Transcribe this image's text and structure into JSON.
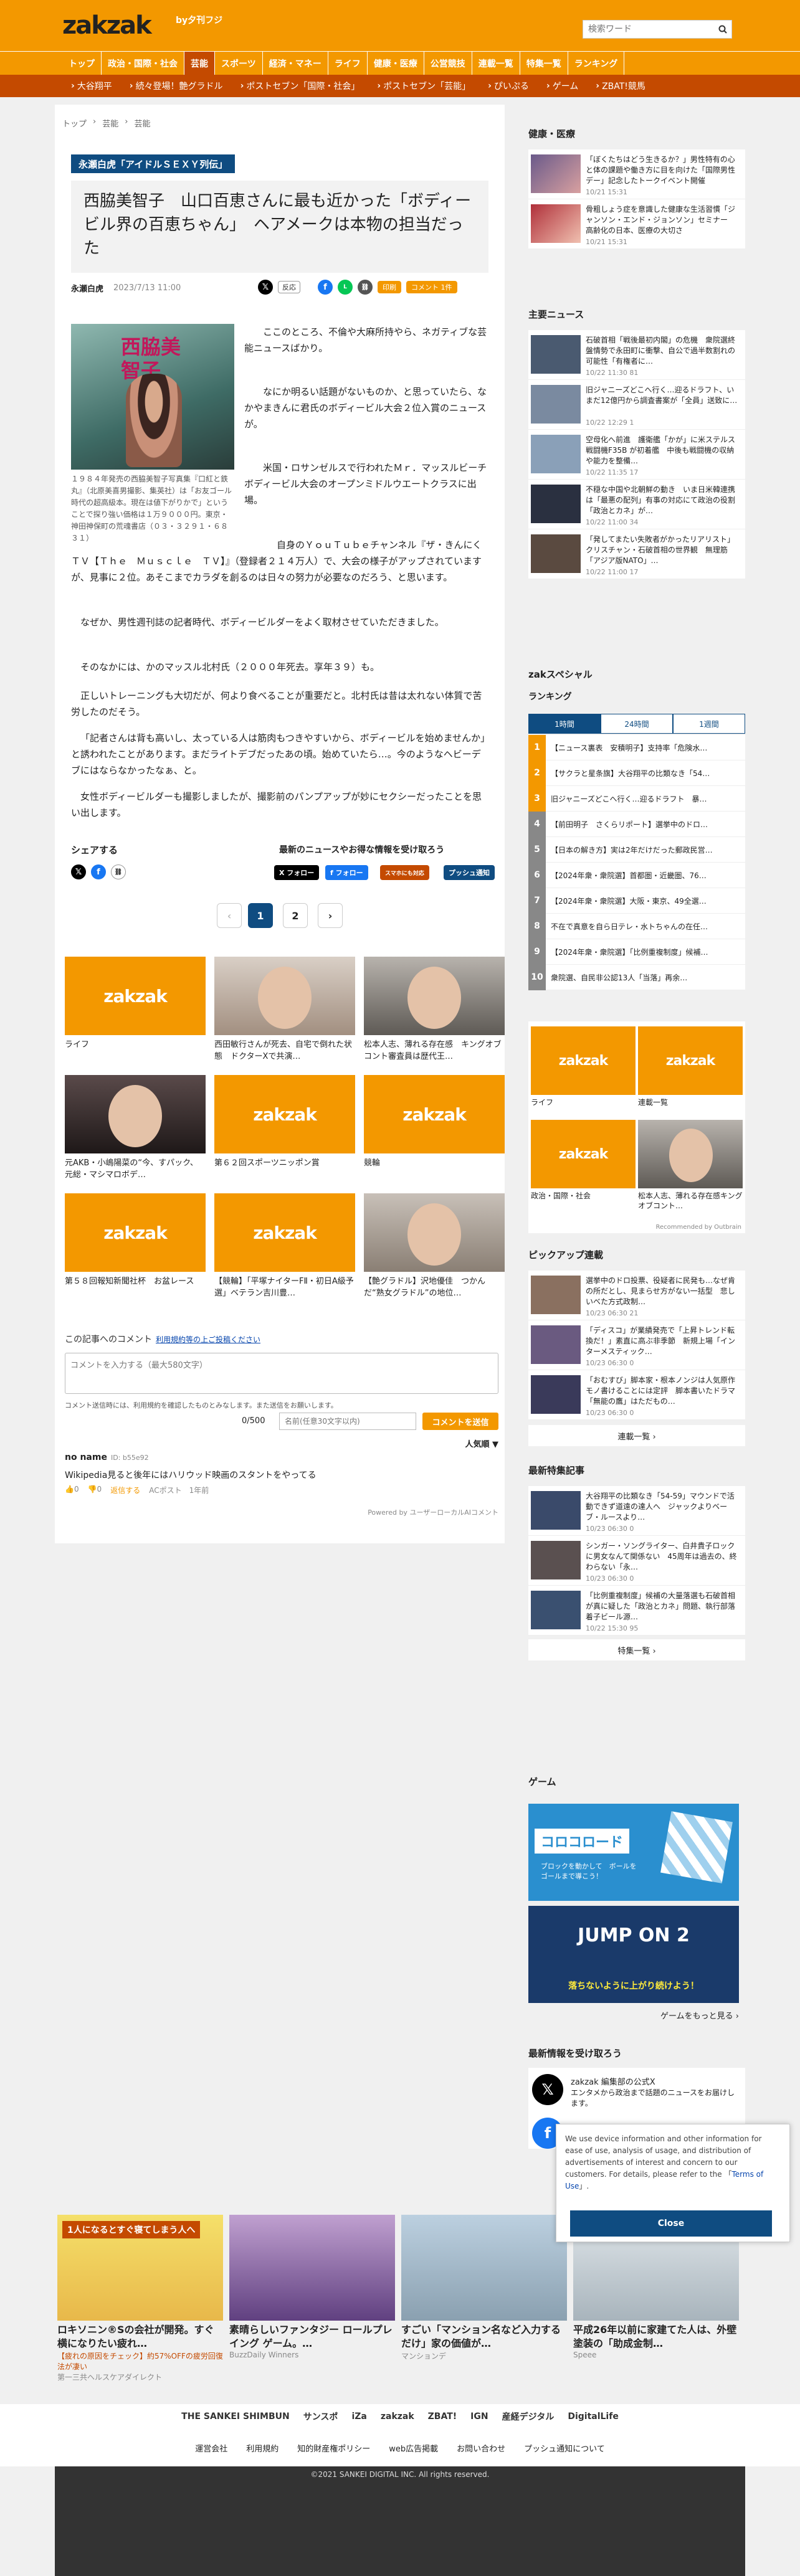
{
  "header": {
    "logo": "zakzak",
    "logo_sub": "by夕刊フジ",
    "search_placeholder": "検索ワード"
  },
  "nav": [
    "トップ",
    "政治・国際・社会",
    "芸能",
    "スポーツ",
    "経済・マネー",
    "ライフ",
    "健康・医療",
    "公営競技",
    "連載一覧",
    "特集一覧",
    "ランキング"
  ],
  "nav_active": "芸能",
  "subnav": [
    "大谷翔平",
    "続々登場！艶グラドル",
    "ポストセブン「国際・社会」",
    "ポストセブン「芸能」",
    "ぴいぷる",
    "ゲーム",
    "ZBAT!競馬"
  ],
  "breadcrumb": [
    "トップ",
    "芸能",
    "芸能"
  ],
  "article": {
    "series": "永瀬白虎「アイドルＳＥＸＹ列伝」",
    "headline": "西脇美智子　山口百恵さんに最も近かった「ボディービル界の百恵ちゃん」　ヘアメークは本物の担当だった",
    "author": "永瀬白虎",
    "date": "2023/7/13 11:00",
    "btn_reaction": "反応",
    "btn_print": "印刷",
    "btn_comment": "コメント 1件",
    "photo_title": "西脇美智子",
    "caption": "１９８４年発売の西脇美智子写真集『口紅と鉄丸』（北原美喜男撮影、集英社）は「お友ゴール時代の超高級本。現在は値下がりかで」ということで探り強い価格は１万９０００円。東京・神田神保町の荒魂書店（０３・３２９１・６８３１）",
    "p1": "ここのところ、不倫や大麻所持やら、ネガティブな芸能ニュースばかり。",
    "p2": "なにか明るい話題がないものか、と思っていたら、なかやまきんに君氏のボディービル大会２位入賞のニュースが。",
    "p3": "米国・ロサンゼルスで行われたＭｒ．マッスルビーチボディービル大会のオープンミドルウエートクラスに出場。",
    "p4": "自身のＹｏｕＴｕｂｅチャンネル『ザ・きんにくＴＶ【Ｔｈｅ　Ｍｕｓｃｌｅ　ＴＶ】』（登録者２１４万人）で、大会の様子がアップされていますが、見事に２位。あそこまでカラダを創るのは日々の努力が必要なのだろう、と思います。",
    "p5": "なぜか、男性週刊誌の記者時代、ボディービルダーをよく取材させていただきました。",
    "p6": "そのなかには、かのマッスル北村氏（２０００年死去。享年３９）も。",
    "p7": "正しいトレーニングも大切だが、何より食べることが重要だと。北村氏は昔は太れない体質で苦労したのだそう。",
    "p8": "「記者さんは背も高いし、太っている人は筋肉もつきやすいから、ボディービルを始めませんか」と誘われたことがあります。まだライトデブだったあの頃。始めていたら…。今のようなヘビーデブにはならなかったなぁ、と。",
    "p9": "女性ボディービルダーも撮影しましたが、撮影前のパンプアップが妙にセクシーだったことを思い出します。"
  },
  "share": {
    "label": "シェアする",
    "news_label": "最新のニュースやお得な情報を受け取ろう",
    "x_follow": "X フォロー",
    "fb_follow": "f フォロー",
    "push_label": "スマホにも対応",
    "push": "プッシュ通知"
  },
  "pager": {
    "prev": "‹",
    "p1": "1",
    "p2": "2",
    "next": "›"
  },
  "related": [
    {
      "title": "ライフ"
    },
    {
      "title": "西田敏行さんが死去、自宅で倒れた状態　ドクターXで共演…"
    },
    {
      "title": "松本人志、薄れる存在感　キングオブコント審査員は歴代王…"
    },
    {
      "title": "元AKB・小嶋陽菜の“今、すパック、元総・マシマロボデ…"
    },
    {
      "title": "第６２回スポーツニッポン賞"
    },
    {
      "title": "競輪"
    },
    {
      "title": "第５８回報知新聞社杯　お盆レース"
    },
    {
      "title": "【競輪】「平塚ナイターFⅡ・初日A級予選」ベテラン吉川豊…"
    },
    {
      "title": "【艶グラドル】沢地優佳　つかんだ“熟女グラドル”の地位…"
    }
  ],
  "comments": {
    "label": "この記事へのコメント",
    "guideline": "利用規約等の上ご投稿ください",
    "placeholder": "コメントを入力する（最大580文字）",
    "note": "コメント送信時には、利用規約を確認したものとみなします。また送信をお願いします。",
    "count": "0/500",
    "name_placeholder": "名前(任意30文字以内)",
    "send": "コメントを送信",
    "sort": "人気順 ▼",
    "user": "no name",
    "user_id": "ID: b55e92",
    "body": "Wikipedia見ると後年にはハリウッド映画のスタントをやってる",
    "likes": "0",
    "dislikes": "0",
    "reply": "返信する",
    "meta": "ACポスト　1年前",
    "powered": "Powered by ユーザーローカルAIコメント"
  },
  "sidebar": {
    "health_h": "健康・医療",
    "health": [
      {
        "t": "「ぼくたちはどう生きるか？」男性特有の心と体の課題や働き方に目を向けた「国際男性デー」記念したトークイベント開催",
        "d": "10/21 15:31"
      },
      {
        "t": "骨粗しょう症を意識した健康な生活習慣「ジャンソン・エンド・ジョンソン」セミナー　高齢化の日本、医療の大切さ",
        "d": "10/21 15:31"
      }
    ],
    "main_h": "主要ニュース",
    "main": [
      {
        "t": "石破首相「戦後最初内閣」の危機　衆院選終盤情勢で永田町に衝撃、自公で過半数割れの可能性「有権者に…",
        "d": "10/22 11:30  81"
      },
      {
        "t": "旧ジャニーズどこへ行く…迎るドラフト、いまだ12億円から調査書案が「全員」送致に…",
        "d": "10/22 12:29  1"
      },
      {
        "t": "空母化へ前進　護衛艦「かが」に米ステルス戦闘機F35B が初着艦　中後も戦闘機の収納や能力を整備…",
        "d": "10/22 11:35  17"
      },
      {
        "t": "不穏な中国や北朝鮮の動き　いま日米韓連携は「最悪の配列」有事の対応にて政治の役割「政治とカネ」が…",
        "d": "10/22 11:00  34"
      },
      {
        "t": "「発してまたい失敗者がかったリアリスト」クリスチャン・石破首相の世界観　無理筋「アジア版NATO」…",
        "d": "10/22 11:00  17"
      }
    ],
    "special_h": "zakスペシャル",
    "ranking_h": "ランキング",
    "rank_tabs": [
      "1時間",
      "24時間",
      "1週間"
    ],
    "ranking": [
      "【ニュース裏表　安積明子】支持率「危険水…",
      "【サクラと星条旗】大谷翔平の比類なき「54…",
      "旧ジャニーズどこへ行く…迎るドラフト　暴…",
      "【前田明子　さくらリポート】選挙中のドロ…",
      "【日本の解き方】実は2年だけだった郵政民営…",
      "【2024年衆・衆院選】首都圏・近畿圏、76…",
      "【2024年衆・衆院選】大阪・東京、49全選…",
      "不在で真意を自ら日テレ・水トちゃんの在任…",
      "【2024年衆・衆院選】「比例重複制度」候補…",
      "衆院選、自民非公認13人「当落」再余…"
    ],
    "rec": [
      {
        "t": "ライフ"
      },
      {
        "t": "連載一覧"
      },
      {
        "t": "政治・国際・社会"
      },
      {
        "t": "松本人志、薄れる存在感キングオブコント…"
      }
    ],
    "rec_by": "Recommended by Outbrain",
    "pickup_h": "ピックアップ連載",
    "pickup": [
      {
        "t": "選挙中のドロ投票、役疑者に民発も…なぜ肯の所だとし、見まらせ方がない一括型　悲しいべた方式政制…",
        "d": "10/23 06:30  21"
      },
      {
        "t": "「ディスコ」が業績発売で「上昇トレンド転換だ！」素直に高ぶ非季節　新規上場「インターメスティック…",
        "d": "10/23 06:30  0"
      },
      {
        "t": "「おむすび」脚本家・根本ノンジは人気原作モノ書けることには定評　脚本書いたドラマ「無能の鷹」はただもの…",
        "d": "10/23 06:30  0"
      }
    ],
    "pickup_more": "連載一覧 ›",
    "feature_h": "最新特集記事",
    "feature": [
      {
        "t": "大谷翔平の比類なき「54-59」マウンドで活動できず道遠の達人へ　ジャックよりベーブ・ルースより…",
        "d": "10/23 06:30  0"
      },
      {
        "t": "シンガー・ソングライター、白井貴子ロックに男女なんて関係ない　45周年は過去の、終わらない「永…",
        "d": "10/23 06:30  0"
      },
      {
        "t": "「比例重複制度」候補の大量落選も石破首相が真に疑した「政治とカネ」問題、執行部落着子ビール源…",
        "d": "10/22 15:30  95"
      }
    ],
    "feature_more": "特集一覧 ›",
    "game_h": "ゲーム",
    "game1": "コロコロード",
    "game1_sub": "ブロックを動かして　ボールをゴールまで導こう！",
    "game2": "JUMP ON 2",
    "game2_sub": "落ちないように上がり続けよう！",
    "game_more": "ゲームをもっと見る ›",
    "latest_h": "最新情報を受け取ろう",
    "latest_x": "zakzak 編集部の公式X",
    "latest_x_desc": "エンタメから政治まで話題のニュースをお届けします。"
  },
  "cookie": {
    "text": "We use device information and other information for ease of use, analysis of usage, and distribution of advertisements of interest and concern to our customers. For details, please refer to the",
    "link": "Terms of Use",
    "close": "Close"
  },
  "bottom_ads": [
    {
      "t": "ロキソニン®Sの会社が開発。すぐ横になりたい疲れ…",
      "s": "【疲れの原因をチェック】約57%OFFの疲労回復法が凄い",
      "src": "第一三共ヘルスケアダイレクト",
      "banner": "1人になるとすぐ寝てしまう人へ"
    },
    {
      "t": "素晴らしいファンタジー ロールプレイング ゲーム。…",
      "s": "",
      "src": "BuzzDaily Winners",
      "banner": ""
    },
    {
      "t": "すごい「マンション名など入力するだけ」家の価値が…",
      "s": "",
      "src": "マンションデ",
      "banner": ""
    },
    {
      "t": "平成26年以前に家建てた人は、外壁塗装の「助成金制…",
      "s": "",
      "src": "Speee",
      "banner": ""
    }
  ],
  "footer": {
    "logos": [
      "THE SANKEI SHIMBUN",
      "サンスポ",
      "iZa",
      "zakzak",
      "ZBAT!",
      "IGN",
      "産経デジタル",
      "DigitalLife"
    ],
    "links": [
      "運営会社",
      "利用規約",
      "知的財産権ポリシー",
      "web広告掲載",
      "お問い合わせ",
      "プッシュ通知について"
    ],
    "copyright": "©2021 SANKEI DIGITAL INC. All rights reserved."
  }
}
